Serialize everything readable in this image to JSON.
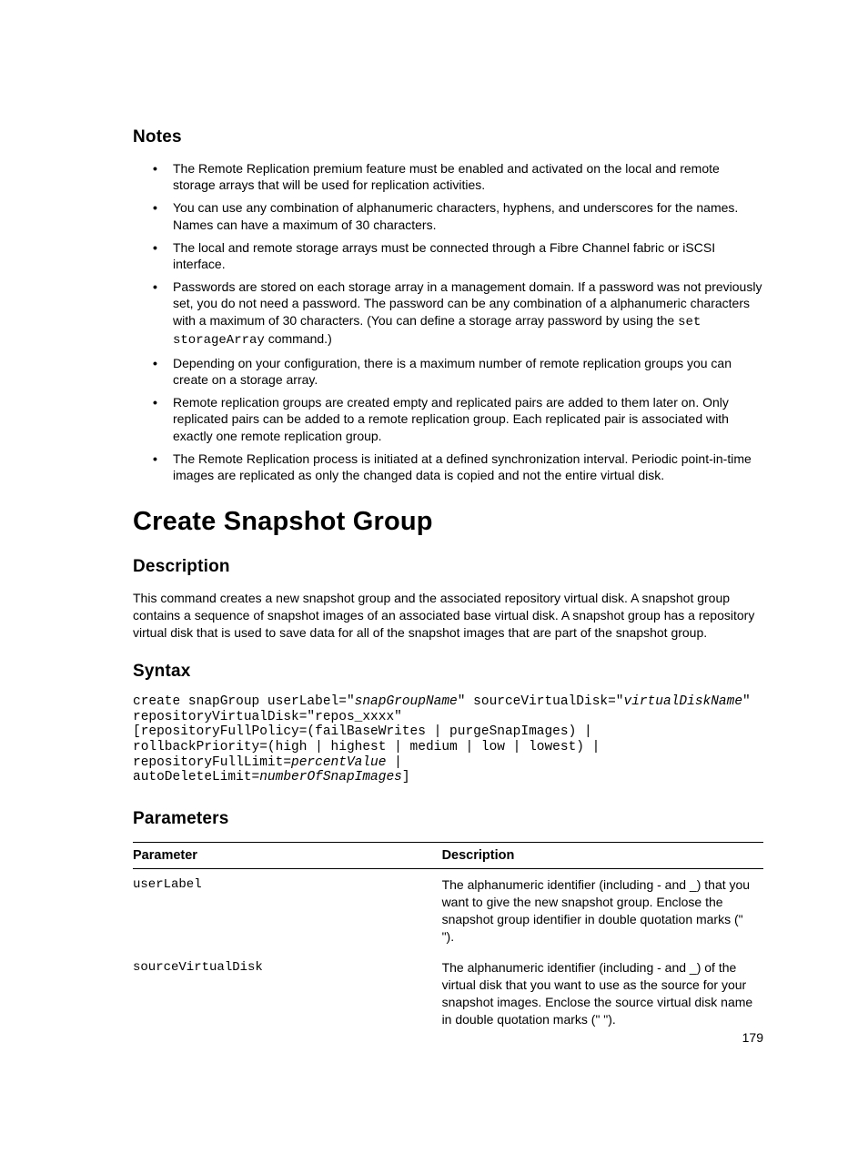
{
  "notes": {
    "heading": "Notes",
    "items": [
      {
        "text": "The Remote Replication premium feature must be enabled and activated on the local and remote storage arrays that will be used for replication activities."
      },
      {
        "text": "You can use any combination of alphanumeric characters, hyphens, and underscores for the names. Names can have a maximum of 30 characters."
      },
      {
        "text": "The local and remote storage arrays must be connected through a Fibre Channel fabric or iSCSI interface."
      },
      {
        "pre": "Passwords are stored on each storage array in a management domain. If a password was not previously set, you do not need a password. The password can be any combination of a alphanumeric characters with a maximum of 30 characters. (You can define a storage array password by using the ",
        "code": "set storageArray",
        "post": " command.)"
      },
      {
        "text": "Depending on your configuration, there is a maximum number of remote replication groups you can create on a storage array."
      },
      {
        "text": "Remote replication groups are created empty and replicated pairs are added to them later on. Only replicated pairs can be added to a remote replication group. Each replicated pair is associated with exactly one remote replication group."
      },
      {
        "text": "The Remote Replication process is initiated at a defined synchronization interval. Periodic point-in-time images are replicated as only the changed data is copied and not the entire virtual disk."
      }
    ]
  },
  "main_heading": "Create Snapshot Group",
  "description": {
    "heading": "Description",
    "body": "This command creates a new snapshot group and the associated repository virtual disk. A snapshot group contains a sequence of snapshot images of an associated base virtual disk. A snapshot group has a repository virtual disk that is used to save data for all of the snapshot images that are part of the snapshot group."
  },
  "syntax": {
    "heading": "Syntax",
    "seg1": "create snapGroup userLabel=\"",
    "ital1": "snapGroupName",
    "seg2": "\" sourceVirtualDisk=\"",
    "ital2": "virtualDiskName",
    "seg3": "\"\nrepositoryVirtualDisk=\"repos_xxxx\"\n[repositoryFullPolicy=(failBaseWrites | purgeSnapImages) |\nrollbackPriority=(high | highest | medium | low | lowest) |\nrepositoryFullLimit=",
    "ital3": "percentValue",
    "seg4": " |\nautoDeleteLimit=",
    "ital4": "numberOfSnapImages",
    "seg5": "]"
  },
  "parameters": {
    "heading": "Parameters",
    "headers": {
      "param": "Parameter",
      "desc": "Description"
    },
    "rows": [
      {
        "param": "userLabel",
        "desc": "The alphanumeric identifier (including - and _) that you want to give the new snapshot group. Enclose the snapshot group identifier in double quotation marks (\" \")."
      },
      {
        "param": "sourceVirtualDisk",
        "desc": "The alphanumeric identifier (including - and _) of the virtual disk that you want to use as the source for your snapshot images. Enclose the source virtual disk name in double quotation marks (\" \")."
      }
    ]
  },
  "page_number": "179"
}
